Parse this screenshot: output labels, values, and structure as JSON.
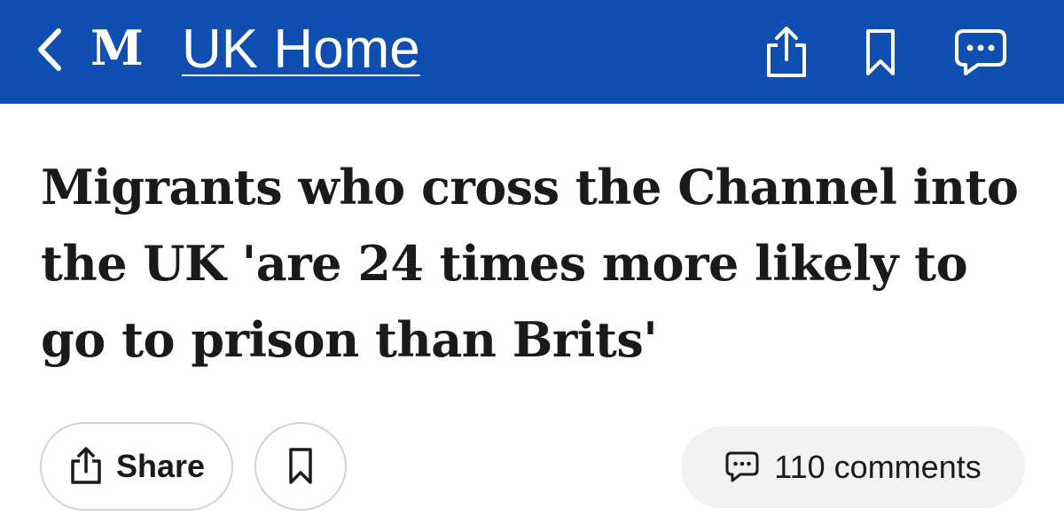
{
  "header": {
    "logo_text": "M",
    "home_link": "UK Home",
    "background_color": "#0f4fb1",
    "icons": [
      "chevron-left-icon",
      "share-icon",
      "bookmark-icon",
      "comments-icon"
    ]
  },
  "article": {
    "headline": "Migrants who cross the Channel into the UK 'are 24 times more likely to go to prison than Brits'"
  },
  "actions": {
    "share_label": "Share",
    "comments_label": "110 comments"
  }
}
